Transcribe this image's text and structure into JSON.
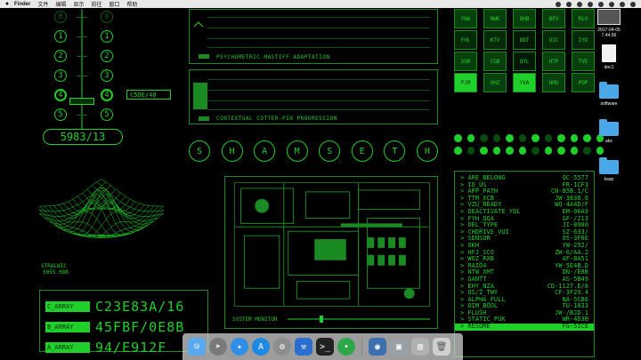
{
  "menubar": {
    "apple": "",
    "app_name": "Finder",
    "items": [
      "文件",
      "编辑",
      "显示",
      "前往",
      "窗口",
      "帮助"
    ]
  },
  "numerals_left": [
    "0",
    "1",
    "2",
    "3",
    "4",
    "5"
  ],
  "numerals_right": [
    "0",
    "1",
    "2",
    "3",
    "4",
    "5"
  ],
  "selector_code": "C5DE/48",
  "hex_display": "5983/13",
  "panel_top": {
    "title": "PSYCHOMETRIC MASTIFF ADAPTATION"
  },
  "panel_mid": {
    "title": "CONTEXTUAL COTTER-PIN PROGRESSION"
  },
  "title_letters": [
    "S",
    "H",
    "A",
    "M",
    "S",
    "E",
    "T",
    "H"
  ],
  "grid_buttons": [
    {
      "label": "YNA",
      "state": "off"
    },
    {
      "label": "NWK",
      "state": "off"
    },
    {
      "label": "OHB",
      "state": "off"
    },
    {
      "label": "BFV",
      "state": "off"
    },
    {
      "label": "RLV",
      "state": "off"
    },
    {
      "label": "FHL",
      "state": "mid"
    },
    {
      "label": "KTV",
      "state": "mid"
    },
    {
      "label": "DBT",
      "state": "dark"
    },
    {
      "label": "UIC",
      "state": "mid"
    },
    {
      "label": "IYO",
      "state": "mid"
    },
    {
      "label": "SUR",
      "state": "off"
    },
    {
      "label": "CGB",
      "state": "off"
    },
    {
      "label": "QYL",
      "state": "dark"
    },
    {
      "label": "HTP",
      "state": "off"
    },
    {
      "label": "TVE",
      "state": "off"
    },
    {
      "label": "PJM",
      "state": "on"
    },
    {
      "label": "UHZ",
      "state": "off"
    },
    {
      "label": "YVA",
      "state": "on"
    },
    {
      "label": "HMU",
      "state": "off"
    },
    {
      "label": "POP",
      "state": "off"
    }
  ],
  "led_row1": [
    1,
    1,
    0,
    0,
    1,
    0,
    1,
    0,
    1,
    1,
    1,
    1
  ],
  "led_row2": [
    1,
    0,
    1,
    1,
    1,
    1,
    0,
    1,
    1,
    1,
    0,
    1
  ],
  "mesh_label_1": "STRALWIC",
  "mesh_label_2": "5055.088",
  "arrays": [
    {
      "tag": "C_ARRAY",
      "value": "C23E83A/16"
    },
    {
      "tag": "B_ARRAY",
      "value": "45FBF/0E8B"
    },
    {
      "tag": "A_ARRAY",
      "value": "94/E912F"
    }
  ],
  "system_monitor_label": "SYSTEM MONITOR",
  "terminal": [
    {
      "name": "> ARE_BELONG",
      "code": "QC-5577"
    },
    {
      "name": "> IO_US",
      "code": "FR-1CF3"
    },
    {
      "name": "> APP_PATH",
      "code": "CN-85B.1/C"
    },
    {
      "name": "> TTM_XCB",
      "code": "JW-3838.6"
    },
    {
      "name": "> VZU_READY",
      "code": "WQ-4A4D/F"
    },
    {
      "name": "> DEACTIVATE_YQL",
      "code": "EM-06A9"
    },
    {
      "name": "> FYH_QQA",
      "code": "GF-/213"
    },
    {
      "name": "> DEL_TYPE",
      "code": "JI-8980"
    },
    {
      "name": "> CHDRIVE_VUI",
      "code": "SZ-633/"
    },
    {
      "name": "> SENSOR",
      "code": "OS-3F0E"
    },
    {
      "name": "> OKH",
      "code": "YW-252/"
    },
    {
      "name": "> HFJ_SCO",
      "code": "ZW-6/AA.2"
    },
    {
      "name": "> WOZ_RXB",
      "code": "AF-8A51"
    },
    {
      "name": "> RAID4",
      "code": "YW-5E4B.D"
    },
    {
      "name": "> NTW_XMT",
      "code": "DN-/E8B"
    },
    {
      "name": "> GANTT",
      "code": "AS-5B49"
    },
    {
      "name": "> EHY_NZA",
      "code": "CD-1127.E/8"
    },
    {
      "name": "> OS/2_TWY",
      "code": "CF-3F29.4"
    },
    {
      "name": "> ALPHA_FULL",
      "code": "NA-5CB6"
    },
    {
      "name": "> DIM_BOOL",
      "code": "TU-1833"
    },
    {
      "name": "> FLUSH",
      "code": "JW-/BJD.1"
    },
    {
      "name": "> STATIC_PUK",
      "code": "WR-4D3B"
    },
    {
      "name": "> RESUME",
      "code": "FG-5ICE"
    }
  ],
  "desktop_icons": [
    {
      "label": "2017-04-05 7.44.56",
      "kind": "screenshot"
    },
    {
      "label": "doc1",
      "kind": "document"
    },
    {
      "label": "software",
      "kind": "folder"
    },
    {
      "label": "abc",
      "kind": "folder"
    },
    {
      "label": "kssp",
      "kind": "folder"
    }
  ],
  "dock_apps": [
    "finder-icon",
    "launchpad-icon",
    "safari-icon",
    "app-store-icon",
    "system-preferences-icon",
    "xcode-icon",
    "terminal-icon",
    "green-app-icon",
    "camera-icon",
    "screenshots-icon",
    "stack-icon",
    "trash-icon"
  ]
}
